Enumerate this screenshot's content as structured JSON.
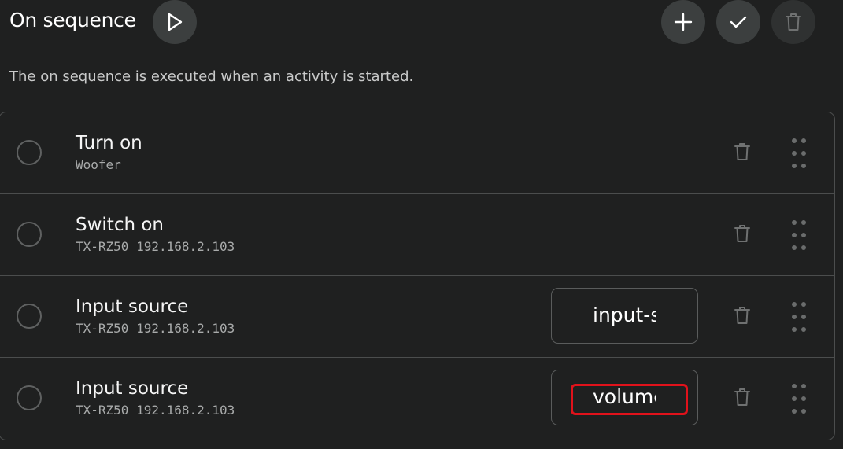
{
  "header": {
    "title": "On sequence",
    "description": "The on sequence is executed when an activity is started."
  },
  "toolbar": {
    "play_icon": "play-icon",
    "add_icon": "plus-icon",
    "confirm_icon": "check-icon",
    "delete_icon": "trash-icon"
  },
  "steps": [
    {
      "title": "Turn on",
      "device": "Woofer",
      "param": ""
    },
    {
      "title": "Switch on",
      "device": "TX-RZ50 192.168.2.103",
      "param": ""
    },
    {
      "title": "Input source",
      "device": "TX-RZ50 192.168.2.103",
      "param": "input-s"
    },
    {
      "title": "Input source",
      "device": "TX-RZ50 192.168.2.103",
      "param": "volume"
    }
  ],
  "colors": {
    "background": "#1f2020",
    "button": "#3c3f3f",
    "border": "#4b4d4d",
    "highlight": "#e0121b"
  }
}
